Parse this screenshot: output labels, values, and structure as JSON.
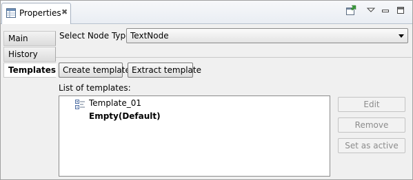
{
  "view": {
    "title": "Properties",
    "close_glyph": "✖",
    "toolbar_icons": [
      "pin-view-icon",
      "view-menu-icon",
      "minimize-icon",
      "maximize-icon"
    ]
  },
  "side_tabs": [
    {
      "label": "Main",
      "active": false
    },
    {
      "label": "History",
      "active": false
    },
    {
      "label": "Templates",
      "active": true
    }
  ],
  "node_type": {
    "label": "Select Node Type",
    "value": "TextNode"
  },
  "actions": {
    "create_label": "Create template",
    "extract_label": "Extract template"
  },
  "templates": {
    "label": "List of templates:",
    "items": [
      {
        "name": "Template_01",
        "bold": false,
        "icon": "template-tree-icon"
      },
      {
        "name": "Empty(Default)",
        "bold": true,
        "icon": ""
      }
    ]
  },
  "side_buttons": {
    "edit_label": "Edit",
    "remove_label": "Remove",
    "set_active_label": "Set as active",
    "enabled": false
  },
  "colors": {
    "tab_border": "#a6b1c0",
    "active_tab_bg": "#ffffff",
    "panel_bg": "#f0f0f0",
    "disabled_text": "#8c8c8c"
  }
}
